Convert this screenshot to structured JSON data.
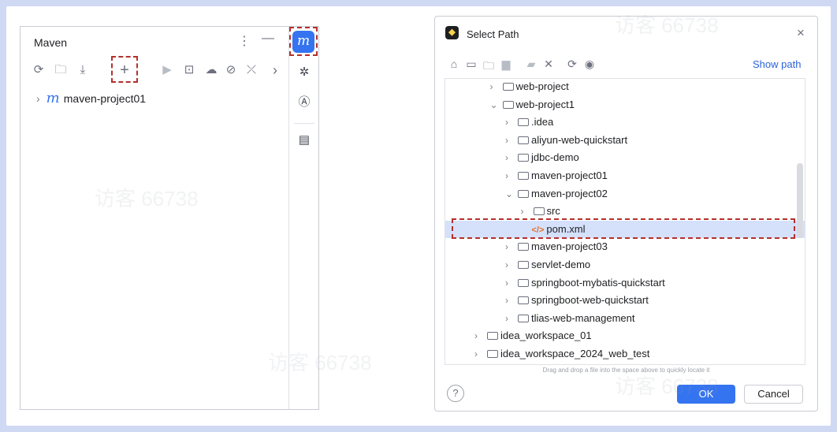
{
  "maven_panel": {
    "title": "Maven",
    "kebab": "⋮",
    "hide": "—",
    "toolbar": [
      {
        "name": "reload-icon",
        "glyph": "⟳"
      },
      {
        "name": "reload-folder-icon",
        "glyph": "🗀"
      },
      {
        "name": "download-icon",
        "glyph": "⤓"
      },
      {
        "name": "add-icon",
        "glyph": "+"
      },
      {
        "name": "run-icon",
        "glyph": "▶"
      },
      {
        "name": "execute-goal-icon",
        "glyph": "⊡"
      },
      {
        "name": "offline-icon",
        "glyph": "☁"
      },
      {
        "name": "skip-tests-icon",
        "glyph": "⊘"
      },
      {
        "name": "collapse-icon",
        "glyph": "⤫"
      },
      {
        "name": "more-icon",
        "glyph": "›"
      }
    ],
    "tree": [
      {
        "label": "maven-project01",
        "icon": "m"
      }
    ],
    "side_strip": {
      "active_tab_glyph": "m",
      "icon2": "✲",
      "icon3": "Ⓐ",
      "icon4": "▤"
    }
  },
  "dialog": {
    "title": "Select Path",
    "close": "×",
    "show_path": "Show path",
    "toolbar_icons": [
      "home-icon",
      "desktop-icon",
      "project-icon",
      "module-icon",
      "new-folder-icon",
      "delete-icon",
      "refresh-icon",
      "hidden-files-icon"
    ],
    "tree": [
      {
        "indent": 3,
        "chev": "›",
        "type": "folder",
        "label": "web-project"
      },
      {
        "indent": 3,
        "chev": "⌄",
        "type": "folder",
        "label": "web-project1"
      },
      {
        "indent": 4,
        "chev": "›",
        "type": "folder",
        "label": ".idea"
      },
      {
        "indent": 4,
        "chev": "›",
        "type": "folder",
        "label": "aliyun-web-quickstart"
      },
      {
        "indent": 4,
        "chev": "›",
        "type": "folder",
        "label": "jdbc-demo"
      },
      {
        "indent": 4,
        "chev": "›",
        "type": "folder",
        "label": "maven-project01"
      },
      {
        "indent": 4,
        "chev": "⌄",
        "type": "folder",
        "label": "maven-project02"
      },
      {
        "indent": 5,
        "chev": "›",
        "type": "folder",
        "label": "src"
      },
      {
        "indent": 5,
        "chev": "",
        "type": "xml",
        "label": "pom.xml",
        "selected": true
      },
      {
        "indent": 4,
        "chev": "›",
        "type": "folder",
        "label": "maven-project03"
      },
      {
        "indent": 4,
        "chev": "›",
        "type": "folder",
        "label": "servlet-demo"
      },
      {
        "indent": 4,
        "chev": "›",
        "type": "folder",
        "label": "springboot-mybatis-quickstart"
      },
      {
        "indent": 4,
        "chev": "›",
        "type": "folder",
        "label": "springboot-web-quickstart"
      },
      {
        "indent": 4,
        "chev": "›",
        "type": "folder",
        "label": "tlias-web-management"
      },
      {
        "indent": 2,
        "chev": "›",
        "type": "folder",
        "label": "idea_workspace_01"
      },
      {
        "indent": 2,
        "chev": "›",
        "type": "folder",
        "label": "idea_workspace_2024_web_test"
      }
    ],
    "hint": "Drag and drop a file into the space above to quickly locate it",
    "help": "?",
    "ok": "OK",
    "cancel": "Cancel"
  },
  "watermark": "访客 66738",
  "colors": {
    "accent": "#3574f0",
    "highlight": "#b4302d",
    "selection": "#d5e1fb"
  }
}
